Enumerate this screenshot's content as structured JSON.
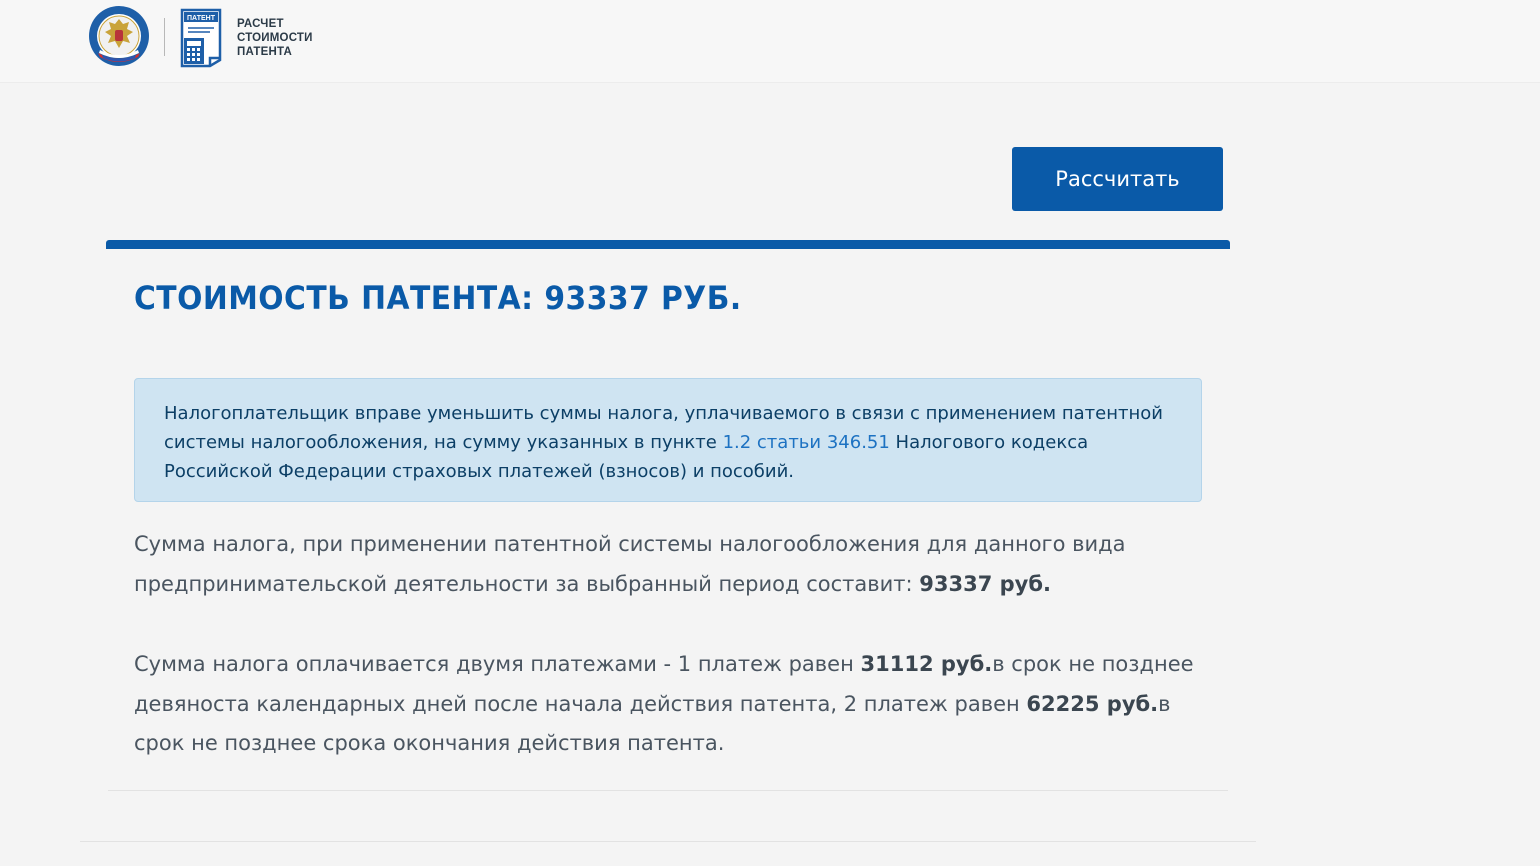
{
  "header": {
    "logo_text_line1": "РАСЧЕТ",
    "logo_text_line2": "СТОИМОСТИ",
    "logo_text_line3": "ПАТЕНТА",
    "patent_badge": "ПАТЕНТ"
  },
  "actions": {
    "calculate_label": "Рассчитать"
  },
  "result": {
    "title": "СТОИМОСТЬ ПАТЕНТА: 93337 РУБ.",
    "info": {
      "text_before_link": "Налогоплательщик вправе уменьшить суммы налога, уплачиваемого в связи с применением патентной системы налогообложения, на сумму указанных в пункте ",
      "link_text": "1.2 статьи 346.51",
      "text_after_link": " Налогового кодекса Российской Федерации страховых платежей (взносов) и пособий."
    },
    "paragraph1": {
      "text": "Сумма налога, при применении патентной системы налогообложения для данного вида предпринимательской деятельности за выбранный период составит: ",
      "amount": "93337 руб."
    },
    "paragraph2": {
      "text1": "Сумма налога оплачивается двумя платежами - 1 платеж равен ",
      "amount1": "31112 руб.",
      "text2": "в срок не позднее девяноста календарных дней после начала действия патента, 2 платеж равен ",
      "amount2": "62225 руб.",
      "text3": "в срок не позднее срока окончания действия патента."
    }
  },
  "colors": {
    "primary": "#0a5aa8",
    "info_bg": "#cfe4f2",
    "link": "#1d72c2"
  },
  "icons": {
    "fns_logo": "fns-emblem-icon",
    "patent_logo": "patent-document-icon"
  }
}
